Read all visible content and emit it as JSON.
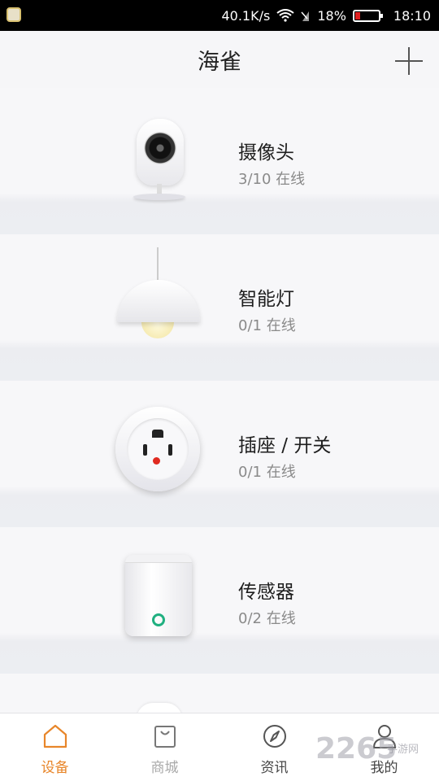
{
  "status_bar": {
    "speed": "40.1K/s",
    "battery": "18%",
    "time": "18:10"
  },
  "header": {
    "title": "海雀"
  },
  "devices": [
    {
      "name": "摄像头",
      "status": "3/10 在线",
      "icon": "camera-icon"
    },
    {
      "name": "智能灯",
      "status": "0/1 在线",
      "icon": "lamp-icon"
    },
    {
      "name": "插座 / 开关",
      "status": "0/1 在线",
      "icon": "socket-icon"
    },
    {
      "name": "传感器",
      "status": "0/2 在线",
      "icon": "sensor-icon"
    }
  ],
  "tabs": [
    {
      "label": "设备",
      "icon": "home-icon",
      "active": true
    },
    {
      "label": "商城",
      "icon": "shopping-bag-icon",
      "active": false
    },
    {
      "label": "资讯",
      "icon": "compass-icon",
      "active": false
    },
    {
      "label": "我的",
      "icon": "person-icon",
      "active": false
    }
  ],
  "watermark": {
    "text": "2265",
    "sub": "手游网"
  },
  "colors": {
    "accent": "#e8862a",
    "background": "#f4f4f6",
    "socket_led": "#e02a20",
    "sensor_led": "#20b080"
  }
}
